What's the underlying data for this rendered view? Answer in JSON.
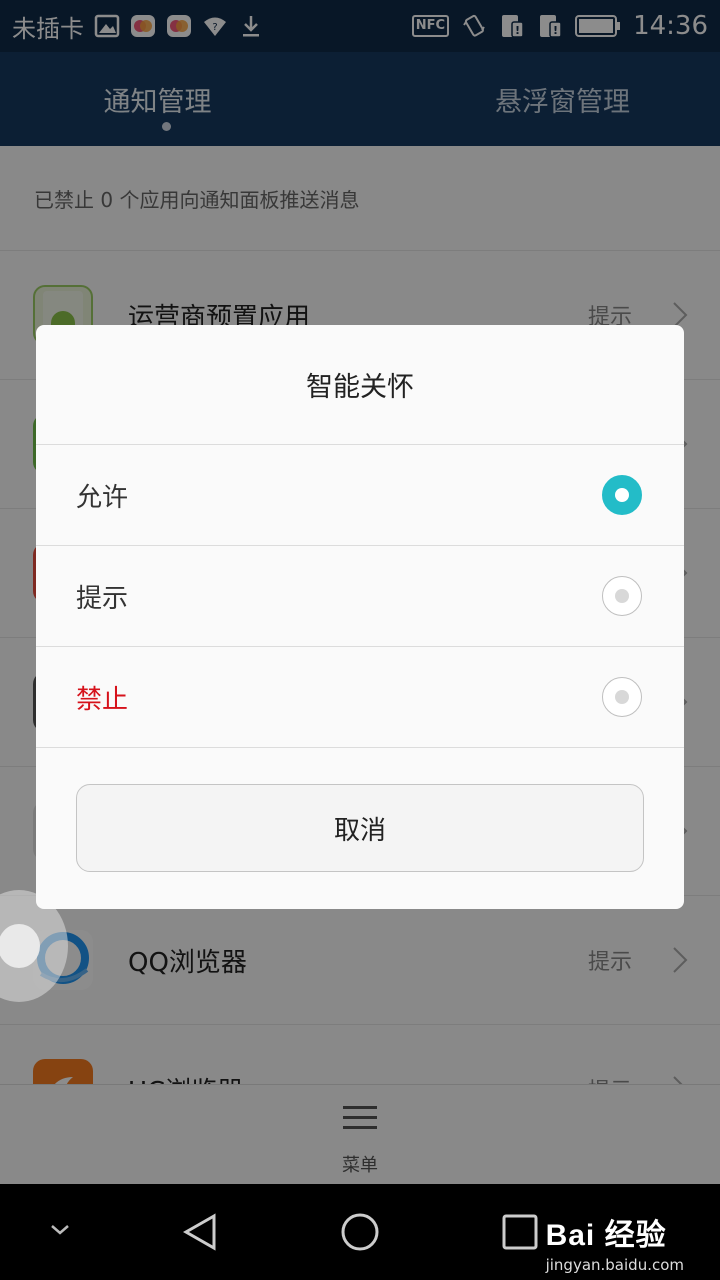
{
  "status_bar": {
    "carrier": "未插卡",
    "nfc": "NFC",
    "time": "14:36"
  },
  "tabs": [
    {
      "label": "通知管理",
      "active": true
    },
    {
      "label": "悬浮窗管理",
      "active": false
    }
  ],
  "summary": "已禁止 0 个应用向通知面板推送消息",
  "apps": [
    {
      "name": "运营商预置应用",
      "status": "提示",
      "icon": "android-icon"
    },
    {
      "name": "",
      "status": "",
      "icon": "green-app-icon"
    },
    {
      "name": "",
      "status": "",
      "icon": "red-app-icon"
    },
    {
      "name": "",
      "status": "",
      "icon": "gray-app-icon"
    },
    {
      "name": "",
      "status": "",
      "icon": "app-icon"
    },
    {
      "name": "QQ浏览器",
      "status": "提示",
      "icon": "qq-browser-icon"
    },
    {
      "name": "UC浏览器",
      "status": "提示",
      "icon": "uc-browser-icon"
    }
  ],
  "bottom_menu": {
    "label": "菜单"
  },
  "dialog": {
    "title": "智能关怀",
    "options": [
      {
        "label": "允许",
        "selected": true,
        "color": "#333333"
      },
      {
        "label": "提示",
        "selected": false,
        "color": "#333333"
      },
      {
        "label": "禁止",
        "selected": false,
        "color": "#d6121b"
      }
    ],
    "cancel_label": "取消"
  },
  "watermark": {
    "logo": "Bai 经验",
    "url": "jingyan.baidu.com"
  },
  "colors": {
    "status_bar_bg": "#0f2a48",
    "tab_bar_bg": "#173a60",
    "accent": "#23bcc8",
    "danger": "#d6121b"
  }
}
